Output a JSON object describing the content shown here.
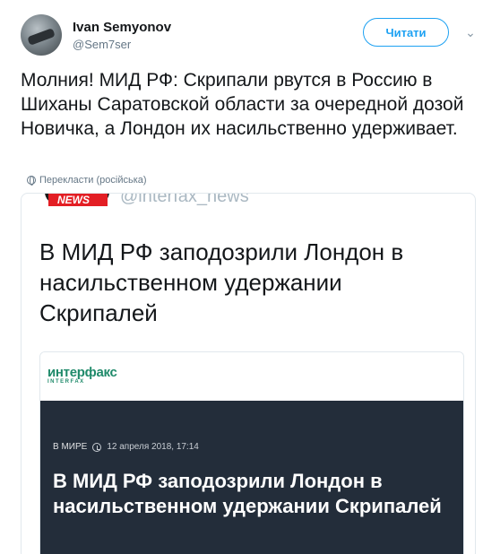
{
  "user": {
    "name": "Ivan Semyonov",
    "handle": "@Sem7ser"
  },
  "follow_label": "Читати",
  "tweet": {
    "text": "Молния! МИД РФ: Скрипали рвутся в Россию в Шиханы Саратовской области за очередной дозой Новичка, а Лондон их насильственно удерживает.",
    "translate_label": "Перекласти (російська)"
  },
  "quoted": {
    "logo_text": "NEWS",
    "handle": "@interfax_news",
    "title": "В МИД РФ заподозрили Лондон в насильственном удержании Скрипалей",
    "card": {
      "logo_word": "интерфакс",
      "logo_sub": "INTERFAX",
      "category": "В МИРЕ",
      "date": "12 апреля 2018, 17:14",
      "title": "В МИД РФ заподозрили Лондон в насильственном удержании Скрипалей"
    }
  },
  "colors": {
    "accent": "#1da1f2",
    "card_bg": "#232d3a",
    "interfax_green": "#1f8a6a",
    "news_red": "#e31e24"
  }
}
